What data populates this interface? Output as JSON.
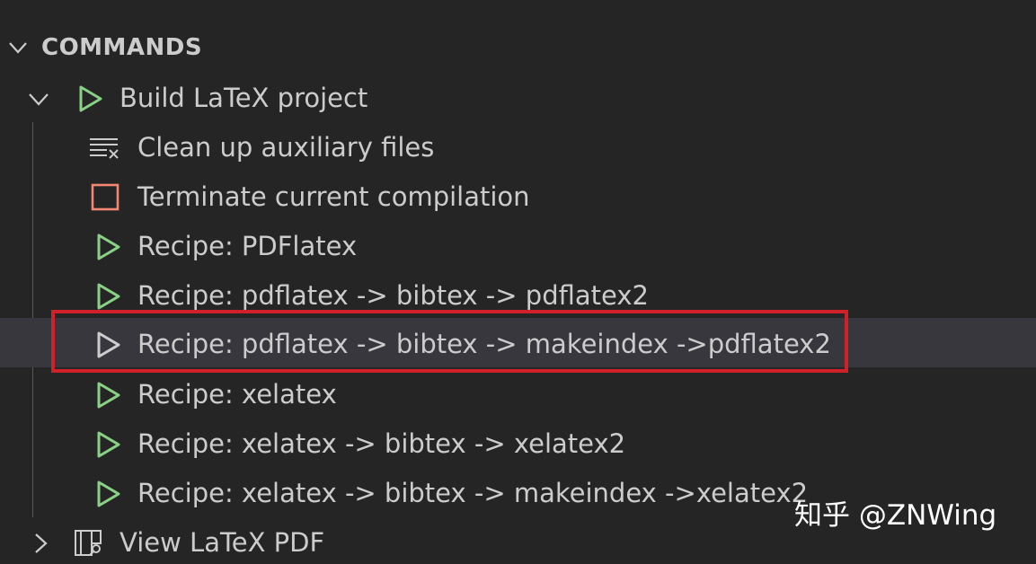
{
  "section": {
    "title": "COMMANDS"
  },
  "parent": {
    "label": "Build LaTeX project",
    "icon": "play-icon"
  },
  "children": [
    {
      "label": "Clean up auxiliary files",
      "icon": "clear-all-icon"
    },
    {
      "label": "Terminate current compilation",
      "icon": "stop-icon"
    },
    {
      "label": "Recipe: PDFlatex",
      "icon": "play-icon"
    },
    {
      "label": "Recipe: pdflatex -> bibtex -> pdflatex2",
      "icon": "play-icon"
    },
    {
      "label": "Recipe: pdflatex -> bibtex -> makeindex ->pdflatex2",
      "icon": "play-icon"
    },
    {
      "label": "Recipe: xelatex",
      "icon": "play-icon"
    },
    {
      "label": "Recipe: xelatex -> bibtex -> xelatex2",
      "icon": "play-icon"
    },
    {
      "label": "Recipe: xelatex -> bibtex -> makeindex ->xelatex2",
      "icon": "play-icon"
    }
  ],
  "view_item": {
    "label": "View LaTeX PDF",
    "icon": "view-pdf-icon"
  },
  "watermark": "知乎 @ZNWing",
  "colors": {
    "background": "#252526",
    "hover": "#37373d",
    "play_green": "#89d185",
    "stop_orange": "#f48771",
    "highlight_red": "#d0202a"
  }
}
